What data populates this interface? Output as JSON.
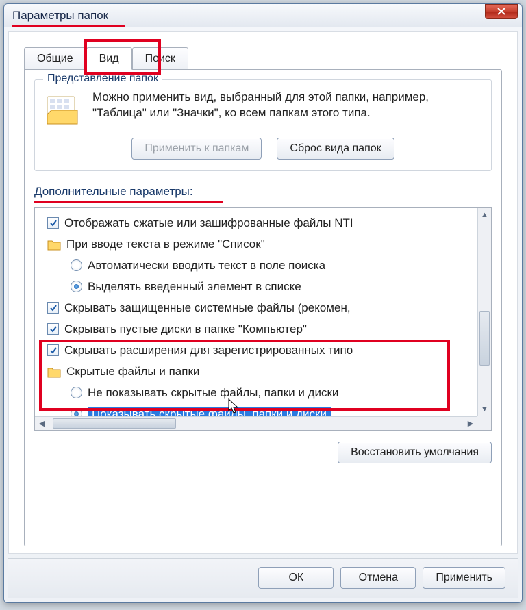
{
  "window": {
    "title": "Параметры папок"
  },
  "tabs": {
    "general": "Общие",
    "view": "Вид",
    "search": "Поиск"
  },
  "group": {
    "title": "Представление папок",
    "text": "Можно применить вид, выбранный для этой папки, например, \"Таблица\" или \"Значки\", ко всем папкам этого типа.",
    "apply_btn": "Применить к папкам",
    "reset_btn": "Сброс вида папок"
  },
  "advanced_label": "Дополнительные параметры:",
  "tree": {
    "show_compressed": "Отображать сжатые или зашифрованные файлы NTI",
    "list_input_folder": "При вводе текста в режиме \"Список\"",
    "auto_search": "Автоматически вводить текст в поле поиска",
    "select_entered": "Выделять введенный элемент в списке",
    "hide_protected": "Скрывать защищенные системные файлы (рекомен,",
    "hide_empty": "Скрывать пустые диски в папке \"Компьютер\"",
    "hide_ext": "Скрывать расширения для зарегистрированных типо",
    "hidden_folder": "Скрытые файлы и папки",
    "dont_show_hidden": "Не показывать скрытые файлы, папки и диски",
    "show_hidden": "Показывать скрытые файлы, папки и диски"
  },
  "restore_defaults": "Восстановить умолчания",
  "buttons": {
    "ok": "ОК",
    "cancel": "Отмена",
    "apply": "Применить"
  }
}
